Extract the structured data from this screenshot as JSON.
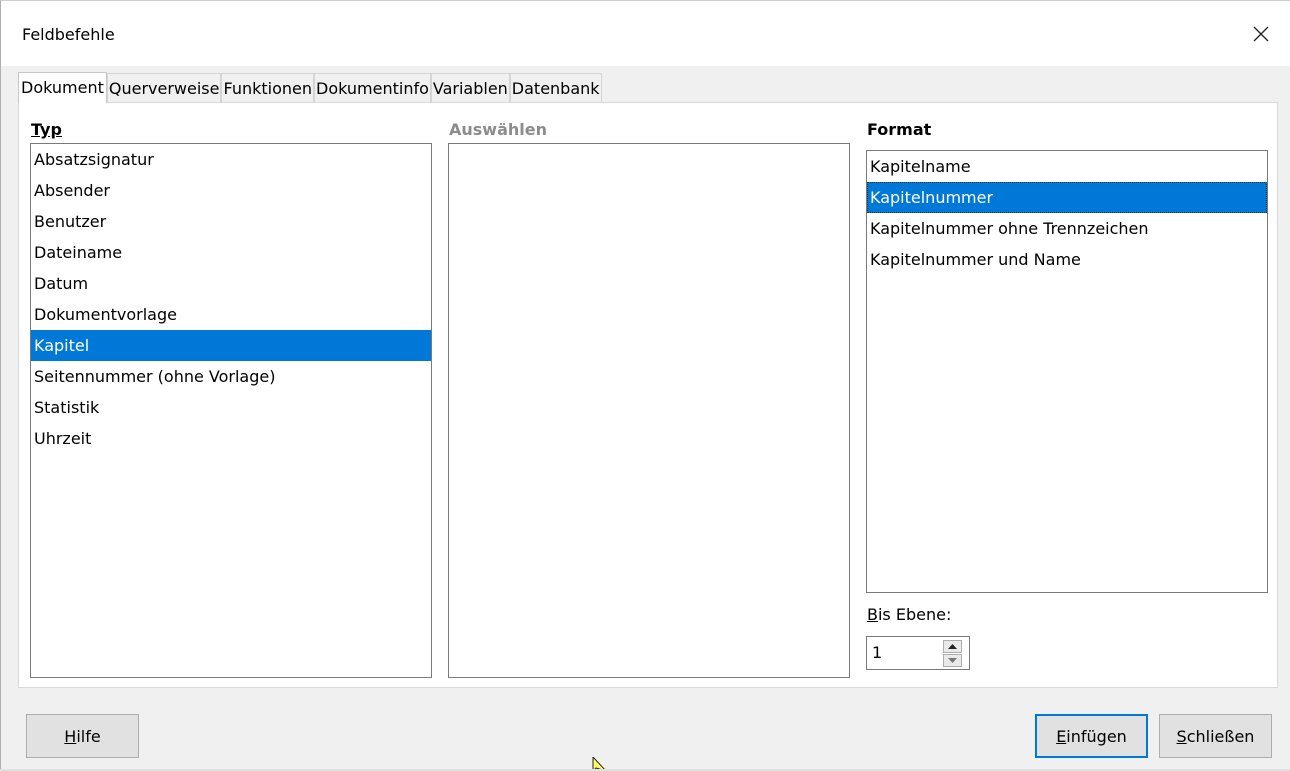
{
  "window": {
    "title": "Feldbefehle",
    "close_glyph": "close-icon"
  },
  "tabs": [
    {
      "label": "Dokument",
      "active": true
    },
    {
      "label": "Querverweise",
      "active": false
    },
    {
      "label": "Funktionen",
      "active": false
    },
    {
      "label": "Dokumentinfo",
      "active": false
    },
    {
      "label": "Variablen",
      "active": false
    },
    {
      "label": "Datenbank",
      "active": false
    }
  ],
  "type_list": {
    "label": "Typ",
    "items": [
      "Absatzsignatur",
      "Absender",
      "Benutzer",
      "Dateiname",
      "Datum",
      "Dokumentvorlage",
      "Kapitel",
      "Seitennummer (ohne Vorlage)",
      "Statistik",
      "Uhrzeit"
    ],
    "selected": "Kapitel"
  },
  "select_list": {
    "label": "Auswählen",
    "items": []
  },
  "format_list": {
    "label": "Format",
    "items": [
      "Kapitelname",
      "Kapitelnummer",
      "Kapitelnummer ohne Trennzeichen",
      "Kapitelnummer und Name"
    ],
    "selected": "Kapitelnummer"
  },
  "level": {
    "label_mnemonic": "B",
    "label_rest": "is Ebene:",
    "value": "1"
  },
  "buttons": {
    "help": {
      "mnemonic": "H",
      "rest": "ilfe"
    },
    "insert": {
      "mnemonic": "E",
      "rest": "infügen"
    },
    "close": {
      "mnemonic": "S",
      "rest": "chließen"
    }
  },
  "colors": {
    "accent": "#0078d7",
    "window_bg": "#f0f0f0",
    "panel_bg": "#ffffff"
  }
}
